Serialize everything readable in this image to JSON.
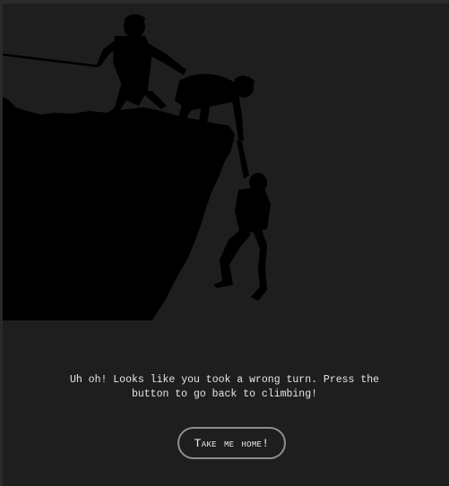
{
  "error_page": {
    "message_line1": "Uh oh! Looks like you took a wrong turn. Press the",
    "message_line2": "button to go back to climbing!",
    "button_label": "Take me home!"
  },
  "illustration": {
    "name": "climbers-silhouette",
    "fill_color": "#000000"
  },
  "colors": {
    "background": "#1f1e1f",
    "text": "#e9e6df",
    "button_border": "#8f8f8f"
  }
}
